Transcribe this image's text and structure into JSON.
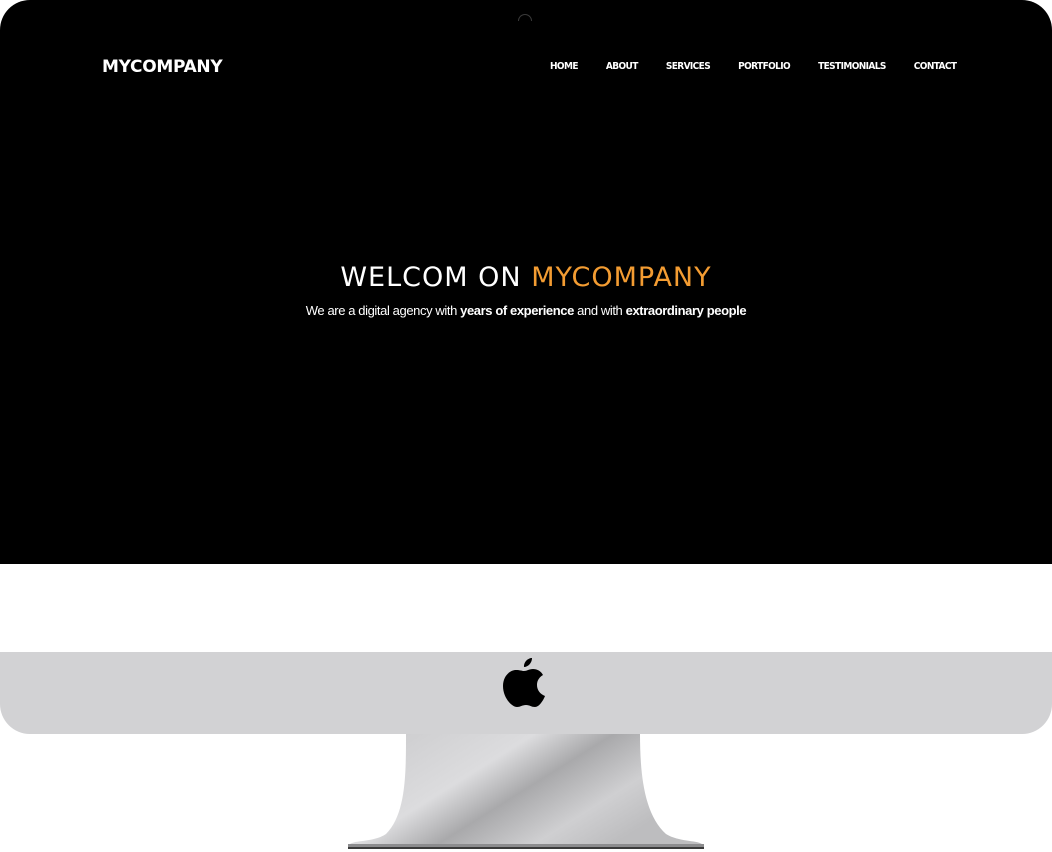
{
  "brand": "MYCOMPANY",
  "nav": {
    "items": [
      "HOME",
      "ABOUT",
      "SERVICES",
      "PORTFOLIO",
      "TESTIMONIALS",
      "CONTACT"
    ]
  },
  "hero": {
    "title_part1": "WELCOM ON ",
    "title_accent": "MYCOMPANY",
    "sub_part1": "We are a digital agency with ",
    "sub_bold1": "years of experience",
    "sub_part2": " and with ",
    "sub_bold2": "extraordinary people"
  },
  "colors": {
    "accent": "#f39c32",
    "screen_bg": "#000000",
    "chin": "#d2d2d4"
  },
  "icons": {
    "chin_logo": "apple-icon",
    "webcam": "camera-icon"
  }
}
